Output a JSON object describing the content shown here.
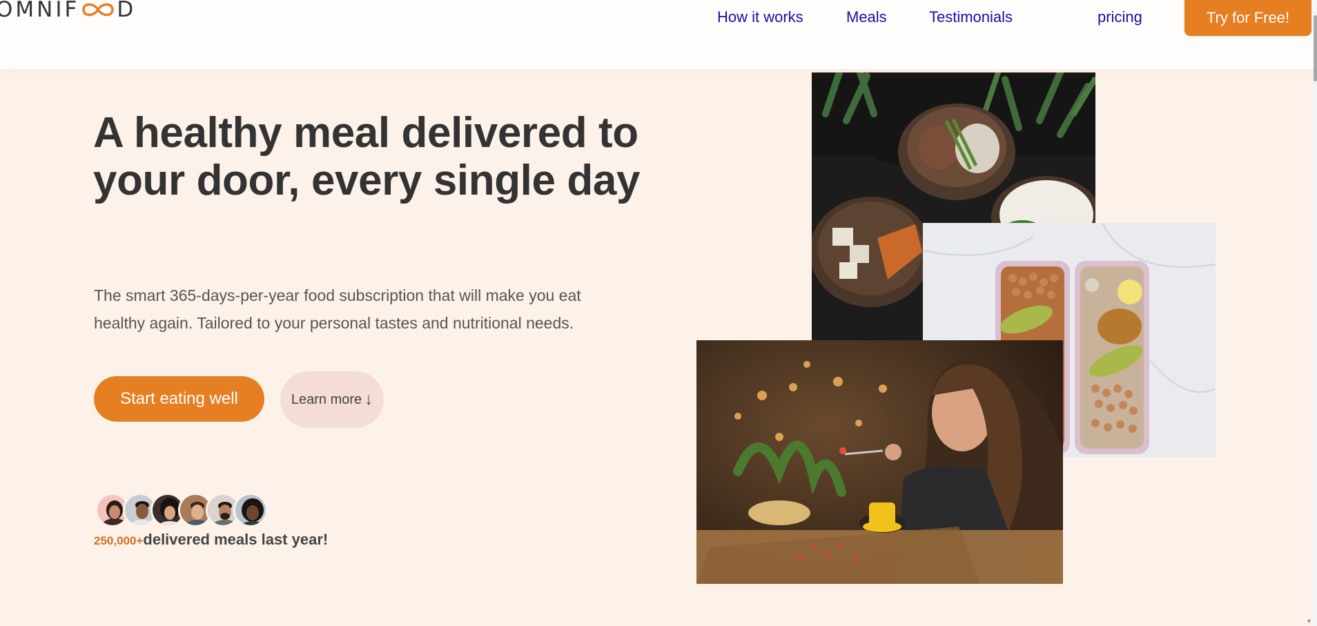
{
  "header": {
    "logo": {
      "prefix": "OMNIF",
      "suffix": "D"
    },
    "nav": [
      {
        "label": "How it works"
      },
      {
        "label": "Meals"
      },
      {
        "label": "Testimonials"
      },
      {
        "label": "pricing"
      }
    ],
    "cta_label": "Try for Free!"
  },
  "hero": {
    "title": "A healthy meal delivered to your door, every single day",
    "description": "The smart 365-days-per-year food subscription that will make you eat healthy again. Tailored to your personal tastes and nutritional needs.",
    "primary_button": "Start eating well",
    "secondary_button": "Learn more",
    "secondary_arrow": "↓",
    "delivered_count": "250,000+",
    "delivered_text": "delivered meals last year!"
  },
  "colors": {
    "accent": "#e67e22",
    "background": "#fdf2e9",
    "header_background": "#fffdfb",
    "link": "#1a0dab",
    "text": "#333333"
  }
}
